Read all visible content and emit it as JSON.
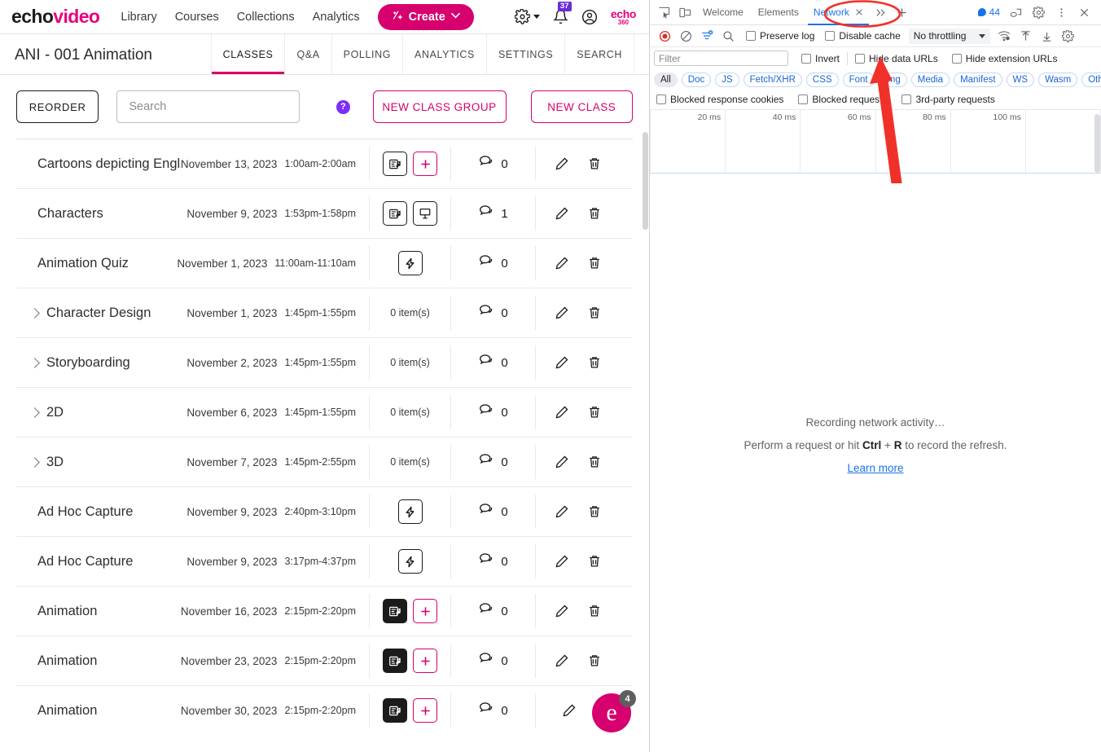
{
  "app": {
    "brand": {
      "part1": "echo",
      "part2": "video"
    },
    "nav": [
      {
        "label": "Library"
      },
      {
        "label": "Courses"
      },
      {
        "label": "Collections"
      },
      {
        "label": "Analytics"
      }
    ],
    "create_button": {
      "label": "Create",
      "icon": "sparkle-icon",
      "caret": "⌄"
    },
    "settings_icon": "gear-icon",
    "notifications": {
      "icon": "bell-icon",
      "badge": "37"
    },
    "account_icon": "user-avatar-icon",
    "logo_right": {
      "line1": "echo",
      "line2": "360"
    },
    "course": {
      "title": "ANI - 001 Animation",
      "tabs": [
        {
          "label": "CLASSES",
          "active": true
        },
        {
          "label": "Q&A",
          "active": false
        },
        {
          "label": "POLLING",
          "active": false
        },
        {
          "label": "ANALYTICS",
          "active": false
        },
        {
          "label": "SETTINGS",
          "active": false
        },
        {
          "label": "SEARCH",
          "active": false
        }
      ]
    },
    "toolbar": {
      "reorder_label": "REORDER",
      "search_placeholder": "Search",
      "search_value": "",
      "help_label": "?",
      "new_class_group_label": "NEW CLASS GROUP",
      "new_class_label": "NEW CLASS"
    },
    "classes": [
      {
        "title": "Cartoons depicting Engl",
        "date": "November 13, 2023",
        "time": "1:00am-2:00am",
        "media": [
          "media-icon",
          "add-media-icon"
        ],
        "items": null,
        "comments": "0",
        "group": false,
        "delete": true
      },
      {
        "title": "Characters",
        "date": "November 9, 2023",
        "time": "1:53pm-1:58pm",
        "media": [
          "media-icon",
          "presentation-icon"
        ],
        "items": null,
        "comments": "1",
        "group": false,
        "delete": true
      },
      {
        "title": "Animation Quiz",
        "date": "November 1, 2023",
        "time": "11:00am-11:10am",
        "media": [
          "quiz-icon"
        ],
        "items": null,
        "comments": "0",
        "group": false,
        "delete": true
      },
      {
        "title": "Character Design",
        "date": "November 1, 2023",
        "time": "1:45pm-1:55pm",
        "media": [],
        "items": "0 item(s)",
        "comments": "0",
        "group": true,
        "delete": true
      },
      {
        "title": "Storyboarding",
        "date": "November 2, 2023",
        "time": "1:45pm-1:55pm",
        "media": [],
        "items": "0 item(s)",
        "comments": "0",
        "group": true,
        "delete": true
      },
      {
        "title": "2D",
        "date": "November 6, 2023",
        "time": "1:45pm-1:55pm",
        "media": [],
        "items": "0 item(s)",
        "comments": "0",
        "group": true,
        "delete": true
      },
      {
        "title": "3D",
        "date": "November 7, 2023",
        "time": "1:45pm-2:55pm",
        "media": [],
        "items": "0 item(s)",
        "comments": "0",
        "group": true,
        "delete": true
      },
      {
        "title": "Ad Hoc Capture",
        "date": "November 9, 2023",
        "time": "2:40pm-3:10pm",
        "media": [
          "quiz-icon"
        ],
        "items": null,
        "comments": "0",
        "group": false,
        "delete": true
      },
      {
        "title": "Ad Hoc Capture",
        "date": "November 9, 2023",
        "time": "3:17pm-4:37pm",
        "media": [
          "quiz-icon"
        ],
        "items": null,
        "comments": "0",
        "group": false,
        "delete": true
      },
      {
        "title": "Animation",
        "date": "November 16, 2023",
        "time": "2:15pm-2:20pm",
        "media": [
          "media-icon-filled",
          "add-media-icon"
        ],
        "items": null,
        "comments": "0",
        "group": false,
        "delete": true
      },
      {
        "title": "Animation",
        "date": "November 23, 2023",
        "time": "2:15pm-2:20pm",
        "media": [
          "media-icon-filled",
          "add-media-icon"
        ],
        "items": null,
        "comments": "0",
        "group": false,
        "delete": true
      },
      {
        "title": "Animation",
        "date": "November 30, 2023",
        "time": "2:15pm-2:20pm",
        "media": [
          "media-icon-filled",
          "add-media-icon"
        ],
        "items": null,
        "comments": "0",
        "group": false,
        "delete": false
      }
    ],
    "fab": {
      "label": "e",
      "badge": "4"
    }
  },
  "devtools": {
    "tabs": [
      {
        "label": "Welcome",
        "active": false,
        "closable": false
      },
      {
        "label": "Elements",
        "active": false,
        "closable": false
      },
      {
        "label": "Network",
        "active": true,
        "closable": true
      }
    ],
    "more_tabs_icon": "»",
    "add_tab_icon": "+",
    "messages": {
      "count": "44",
      "icon": "message-icon"
    },
    "icons": {
      "inspect": "inspect-element-icon",
      "device": "device-toolbar-icon",
      "cast": "cast-icon",
      "settings": "gear-icon",
      "more": "more-vertical-icon",
      "close": "close-icon"
    },
    "toolbar": {
      "record_icon": "record-stop-icon",
      "clear_icon": "clear-icon",
      "filter_icon": "filter-icon",
      "search_icon": "search-icon",
      "preserve_log": {
        "label": "Preserve log",
        "checked": false
      },
      "disable_cache": {
        "label": "Disable cache",
        "checked": false
      },
      "throttling": "No throttling",
      "network_conditions_icon": "wifi-settings-icon",
      "import_icon": "upload-icon",
      "export_icon": "download-icon",
      "settings_icon": "gear-icon"
    },
    "filterbar": {
      "placeholder": "Filter",
      "value": "",
      "invert": {
        "label": "Invert",
        "checked": false
      },
      "hide_data_urls": {
        "label": "Hide data URLs",
        "checked": false
      },
      "hide_extension_urls": {
        "label": "Hide extension URLs",
        "checked": false
      }
    },
    "types": [
      "All",
      "Doc",
      "JS",
      "Fetch/XHR",
      "CSS",
      "Font",
      "Img",
      "Media",
      "Manifest",
      "WS",
      "Wasm",
      "Other"
    ],
    "active_type": "All",
    "blocked": [
      {
        "label": "Blocked response cookies",
        "checked": false
      },
      {
        "label": "Blocked requests",
        "checked": false
      },
      {
        "label": "3rd-party requests",
        "checked": false
      }
    ],
    "timeline_ticks": [
      "20 ms",
      "40 ms",
      "60 ms",
      "80 ms",
      "100 ms"
    ],
    "empty_state": {
      "line1": "Recording network activity…",
      "line2_prefix": "Perform a request or hit ",
      "line2_key1": "Ctrl",
      "line2_plus": " + ",
      "line2_key2": "R",
      "line2_suffix": " to record the refresh.",
      "learn_more": "Learn more"
    }
  },
  "annotations": {
    "ellipse_target": "Network",
    "arrow_target": "Disable cache",
    "color": "#f0312a"
  },
  "colors": {
    "brand_pink": "#e6007e",
    "create_pink": "#d6006e",
    "devtools_blue": "#1a73e8",
    "badge_purple": "#6c2bd9",
    "annotation_red": "#f0312a"
  }
}
